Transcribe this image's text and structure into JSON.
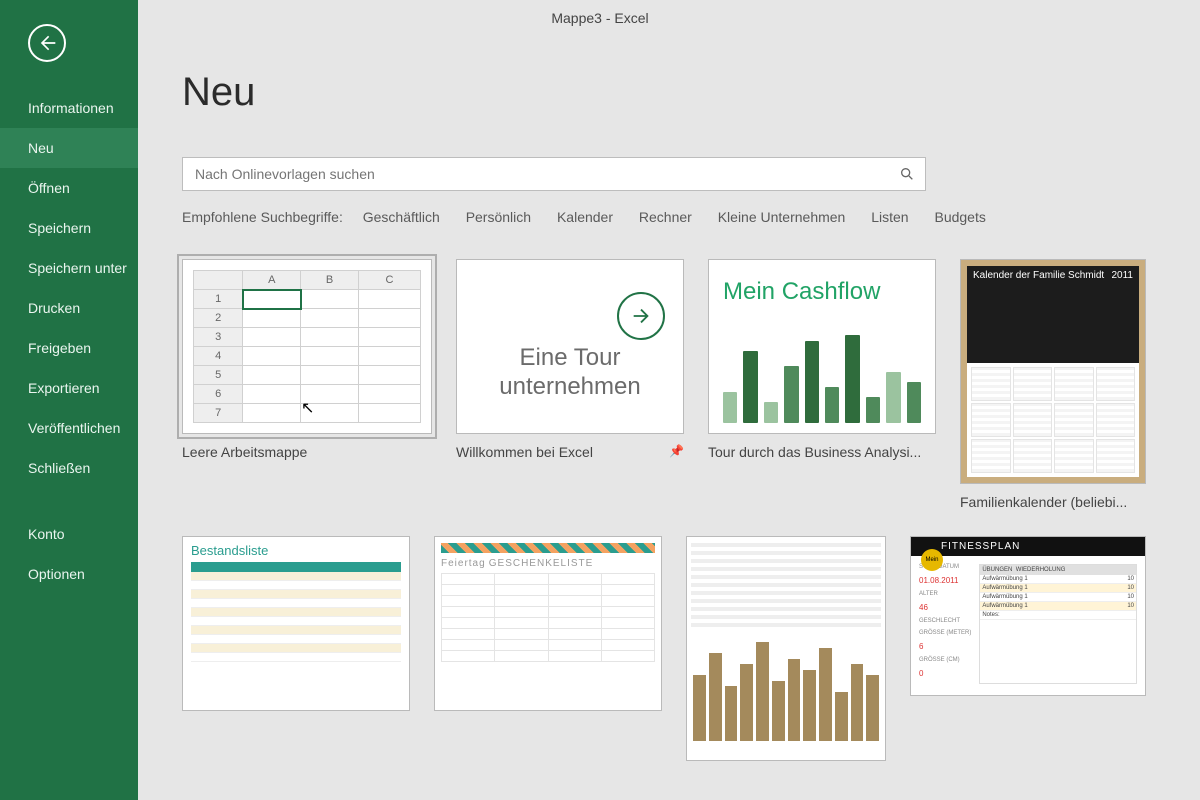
{
  "window_title": "Mappe3 - Excel",
  "page_title": "Neu",
  "sidebar": {
    "items": [
      {
        "label": "Informationen"
      },
      {
        "label": "Neu",
        "selected": true
      },
      {
        "label": "Öffnen"
      },
      {
        "label": "Speichern"
      },
      {
        "label": "Speichern unter"
      },
      {
        "label": "Drucken"
      },
      {
        "label": "Freigeben"
      },
      {
        "label": "Exportieren"
      },
      {
        "label": "Veröffentlichen"
      },
      {
        "label": "Schließen"
      }
    ],
    "bottom": [
      {
        "label": "Konto"
      },
      {
        "label": "Optionen"
      }
    ]
  },
  "search": {
    "placeholder": "Nach Onlinevorlagen suchen"
  },
  "suggest": {
    "label": "Empfohlene Suchbegriffe:",
    "items": [
      "Geschäftlich",
      "Persönlich",
      "Kalender",
      "Rechner",
      "Kleine Unternehmen",
      "Listen",
      "Budgets"
    ]
  },
  "templates": {
    "t1": {
      "caption": "Leere Arbeitsmappe",
      "cols": [
        "A",
        "B",
        "C"
      ],
      "rows": [
        "1",
        "2",
        "3",
        "4",
        "5",
        "6",
        "7"
      ]
    },
    "t2": {
      "caption": "Willkommen bei Excel",
      "line1": "Eine Tour",
      "line2": "unternehmen",
      "pinned": true
    },
    "t3": {
      "caption": "Tour durch das Business Analysi...",
      "headline": "Mein Cashflow"
    },
    "t4": {
      "caption": "Familienkalender (beliebi...",
      "title": "Kalender der Familie Schmidt",
      "year": "2011"
    },
    "t5": {
      "title": "Bestandsliste"
    },
    "t6": {
      "title1": "Feiertag",
      "title2": "GESCHENKELISTE"
    },
    "t8": {
      "badge": "Mein",
      "title": "FITNESSPLAN",
      "fields": [
        {
          "k": "STARTDATUM",
          "v": "01.08.2011"
        },
        {
          "k": "ALTER",
          "v": "46"
        },
        {
          "k": "GESCHLECHT",
          "v": ""
        },
        {
          "k": "GRÖSSE (METER)",
          "v": "6"
        },
        {
          "k": "GRÖSSE (CM)",
          "v": "0"
        }
      ],
      "table_head": [
        "ÜBUNGEN",
        "WIEDERHOLUNG"
      ],
      "table_rows": [
        [
          "Aufwärmübung 1",
          "10"
        ],
        [
          "Aufwärmübung 1",
          "10"
        ],
        [
          "Aufwärmübung 1",
          "10"
        ],
        [
          "Aufwärmübung 1",
          "10"
        ]
      ],
      "notes_label": "Notes:"
    }
  }
}
